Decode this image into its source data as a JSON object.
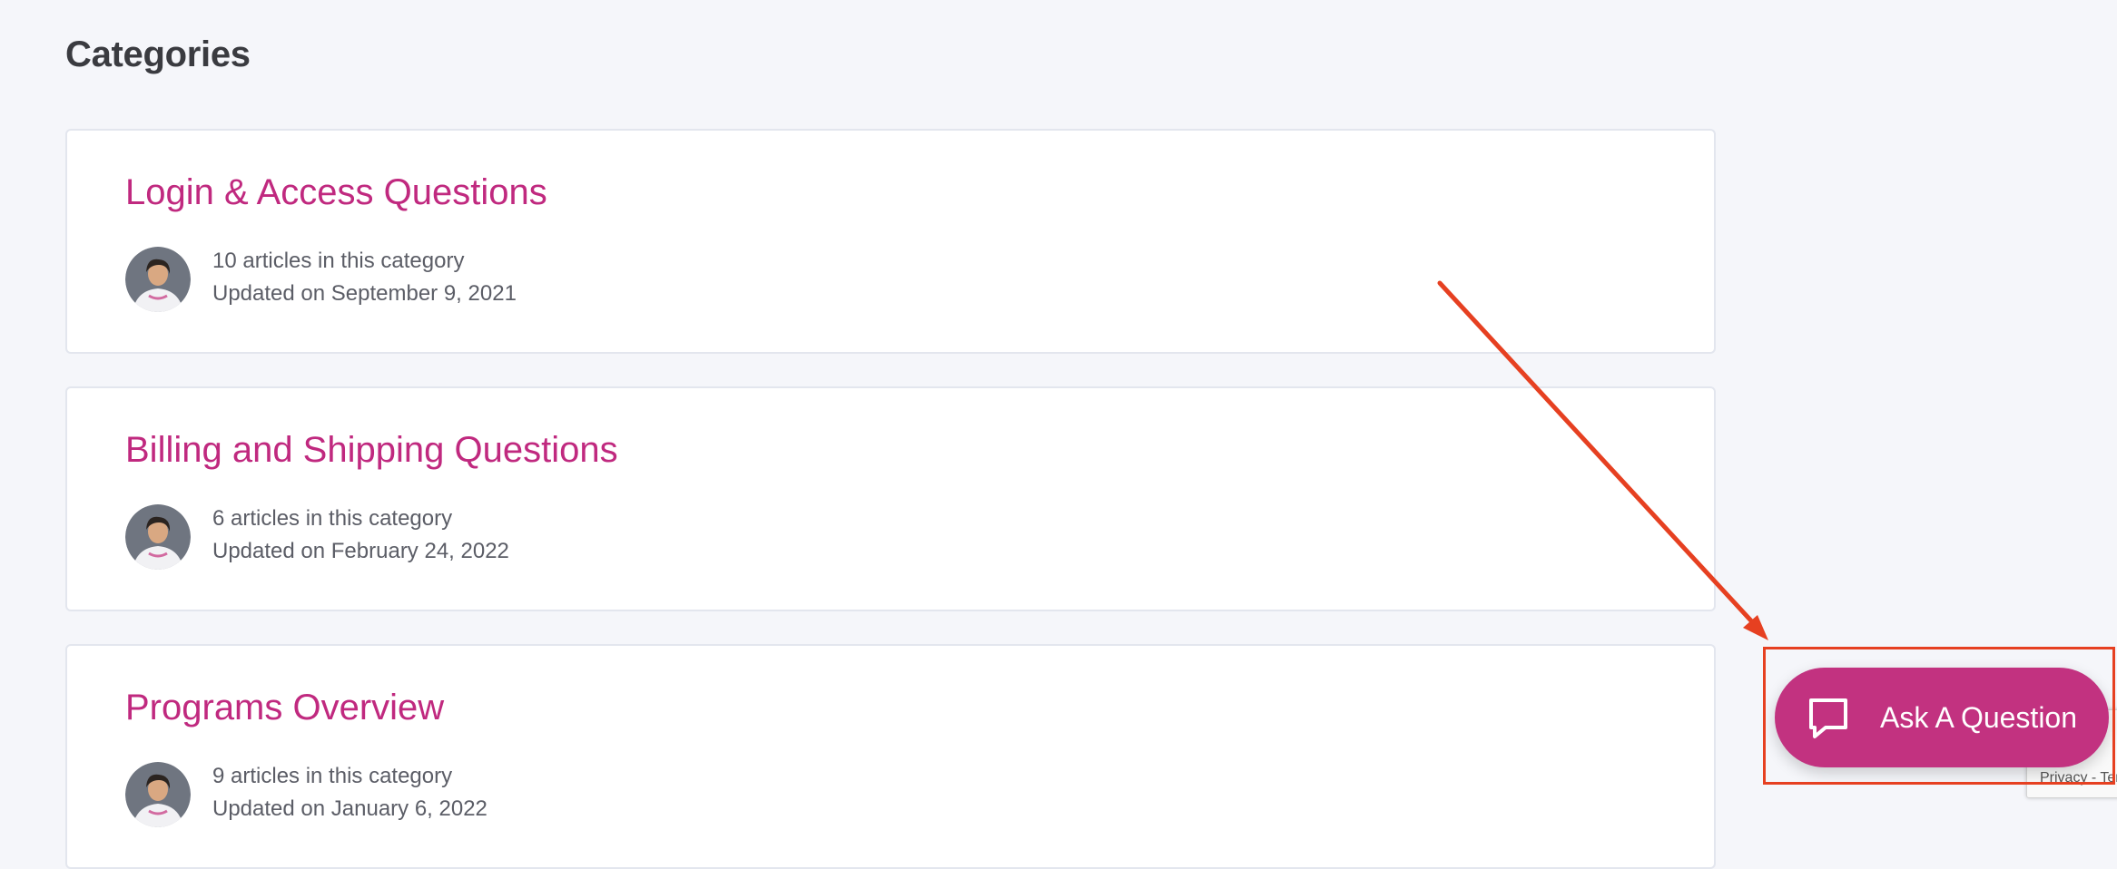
{
  "page": {
    "title": "Categories"
  },
  "categories": [
    {
      "title": "Login & Access Questions",
      "count_text": "10 articles in this category",
      "updated_text": "Updated on September 9, 2021"
    },
    {
      "title": "Billing and Shipping Questions",
      "count_text": "6 articles in this category",
      "updated_text": "Updated on February 24, 2022"
    },
    {
      "title": "Programs Overview",
      "count_text": "9 articles in this category",
      "updated_text": "Updated on January 6, 2022"
    }
  ],
  "ask_button": {
    "label": "Ask A Question",
    "icon": "chat-bubble-icon"
  },
  "recaptcha": {
    "text": "Privacy - Terms"
  },
  "annotation": {
    "color": "#e64021"
  },
  "colors": {
    "accent": "#c0297f",
    "button": "#c23280",
    "background": "#f5f6fa"
  }
}
